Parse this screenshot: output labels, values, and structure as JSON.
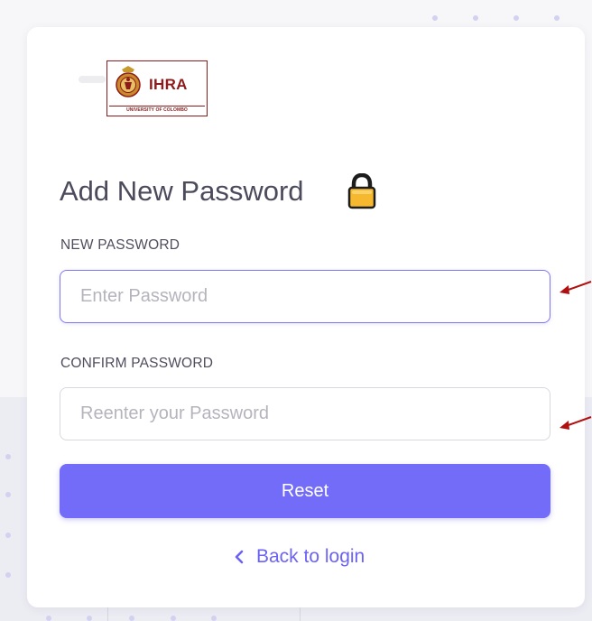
{
  "logo": {
    "name": "IHRA",
    "subtitle": "UNIVERSITY OF COLOMBO",
    "brand_color": "#8e1b1b"
  },
  "page": {
    "title": "Add New Password",
    "title_icon": "lock-icon"
  },
  "form": {
    "new_password": {
      "label": "NEW PASSWORD",
      "placeholder": "Enter Password",
      "value": ""
    },
    "confirm_password": {
      "label": "CONFIRM PASSWORD",
      "placeholder": "Reenter your Password",
      "value": ""
    },
    "submit_label": "Reset"
  },
  "back_link": {
    "label": "Back to login",
    "icon": "chevron-left-icon"
  },
  "colors": {
    "primary": "#736cf8",
    "annotation_arrow": "#b01010"
  }
}
